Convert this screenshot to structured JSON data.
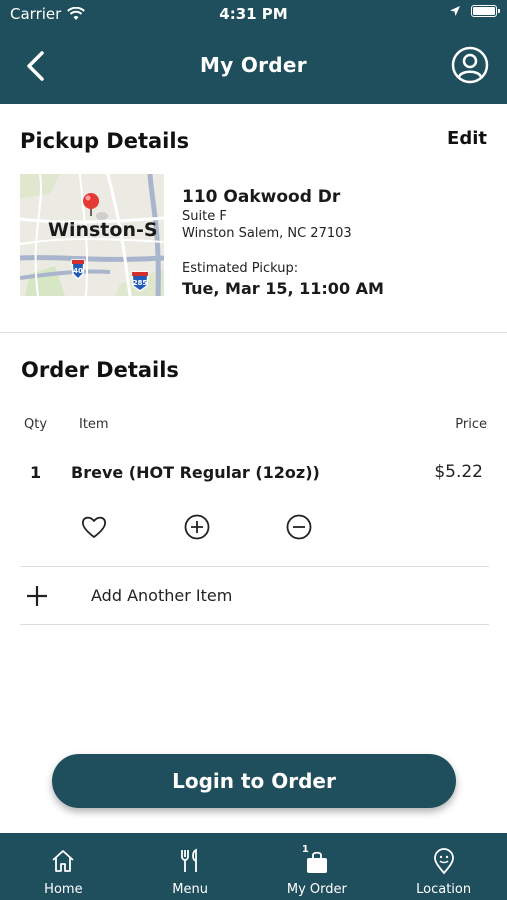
{
  "status_bar": {
    "carrier": "Carrier",
    "time": "4:31 PM"
  },
  "header": {
    "title": "My Order"
  },
  "pickup": {
    "title": "Pickup Details",
    "edit_label": "Edit",
    "map_label": "Winston-S",
    "map_shields": [
      "40",
      "285"
    ],
    "address_line1": "110 Oakwood Dr",
    "address_line2": "Suite F",
    "address_line3": "Winston Salem, NC 27103",
    "estimated_label": "Estimated Pickup:",
    "estimated_value": "Tue, Mar 15, 11:00 AM"
  },
  "order": {
    "title": "Order Details",
    "columns": {
      "qty": "Qty",
      "item": "Item",
      "price": "Price"
    },
    "items": [
      {
        "qty": "1",
        "name": "Breve (HOT Regular (12oz))",
        "price": "$5.22"
      }
    ],
    "add_label": "Add Another Item"
  },
  "login_button": "Login to Order",
  "tabs": [
    {
      "label": "Home",
      "icon": "home-icon"
    },
    {
      "label": "Menu",
      "icon": "utensils-icon"
    },
    {
      "label": "My Order",
      "icon": "bag-icon",
      "badge": "1"
    },
    {
      "label": "Location",
      "icon": "location-pin-icon"
    }
  ],
  "colors": {
    "primary": "#1f4e5c",
    "background": "#ffffff",
    "divider": "#dedede"
  }
}
